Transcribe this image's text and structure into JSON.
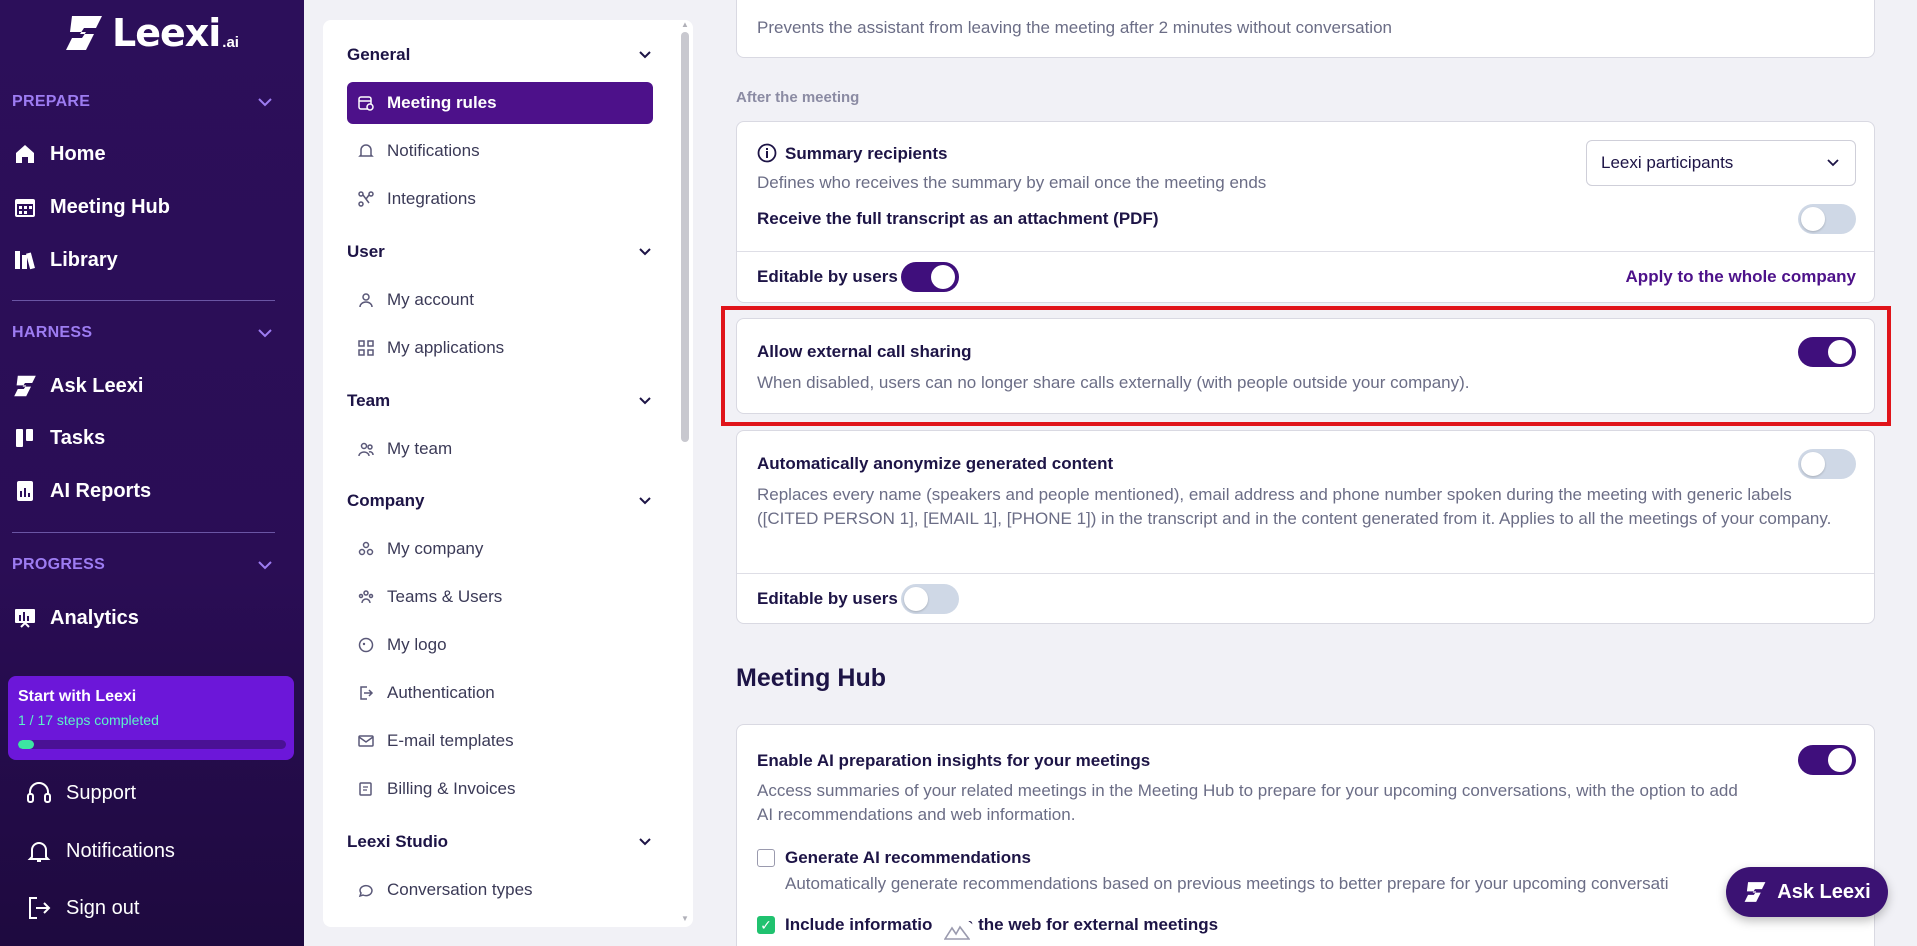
{
  "logo": {
    "name": "Leexi",
    "suffix": ".ai"
  },
  "sidebar": {
    "sections": [
      {
        "label": "PREPARE",
        "items": [
          {
            "label": "Home",
            "icon": "home-icon"
          },
          {
            "label": "Meeting Hub",
            "icon": "calendar-icon"
          },
          {
            "label": "Library",
            "icon": "library-icon"
          }
        ]
      },
      {
        "label": "HARNESS",
        "items": [
          {
            "label": "Ask Leexi",
            "icon": "leexi-icon"
          },
          {
            "label": "Tasks",
            "icon": "tasks-icon"
          },
          {
            "label": "AI Reports",
            "icon": "report-icon"
          }
        ]
      },
      {
        "label": "PROGRESS",
        "items": [
          {
            "label": "Analytics",
            "icon": "analytics-icon"
          }
        ]
      }
    ],
    "start_card": {
      "title": "Start with Leexi",
      "steps": "1 / 17 steps completed",
      "progress": 0.06
    },
    "bottom": [
      {
        "label": "Support",
        "icon": "headset-icon"
      },
      {
        "label": "Notifications",
        "icon": "bell-icon"
      },
      {
        "label": "Sign out",
        "icon": "sign-out-icon"
      }
    ]
  },
  "settings_menu": {
    "groups": [
      {
        "label": "General",
        "items": [
          {
            "label": "Meeting rules",
            "icon": "calendar-cog-icon",
            "active": true
          },
          {
            "label": "Notifications",
            "icon": "bell-icon"
          },
          {
            "label": "Integrations",
            "icon": "integrations-icon"
          }
        ]
      },
      {
        "label": "User",
        "items": [
          {
            "label": "My account",
            "icon": "user-icon"
          },
          {
            "label": "My applications",
            "icon": "apps-icon"
          }
        ]
      },
      {
        "label": "Team",
        "items": [
          {
            "label": "My team",
            "icon": "team-icon"
          }
        ]
      },
      {
        "label": "Company",
        "items": [
          {
            "label": "My company",
            "icon": "company-icon"
          },
          {
            "label": "Teams & Users",
            "icon": "users-icon"
          },
          {
            "label": "My logo",
            "icon": "logo-icon"
          },
          {
            "label": "Authentication",
            "icon": "auth-icon"
          },
          {
            "label": "E-mail templates",
            "icon": "mail-icon"
          },
          {
            "label": "Billing & Invoices",
            "icon": "billing-icon"
          }
        ]
      },
      {
        "label": "Leexi Studio",
        "items": [
          {
            "label": "Conversation types",
            "icon": "conversation-icon"
          }
        ]
      }
    ]
  },
  "main": {
    "top_card": {
      "description": "Prevents the assistant from leaving the meeting after 2 minutes without conversation"
    },
    "after_meeting_label": "After the meeting",
    "summary": {
      "title": "Summary recipients",
      "description": "Defines who receives the summary by email once the meeting ends",
      "select_value": "Leexi participants",
      "transcript_label": "Receive the full transcript as an attachment (PDF)",
      "transcript_on": false,
      "editable_label": "Editable by users",
      "editable_on": true,
      "apply_link": "Apply to the whole company"
    },
    "external_sharing": {
      "title": "Allow external call sharing",
      "description": "When disabled, users can no longer share calls externally (with people outside your company).",
      "on": true
    },
    "anonymize": {
      "title": "Automatically anonymize generated content",
      "description": "Replaces every name (speakers and people mentioned), email address and phone number spoken during the meeting with generic labels ([CITED PERSON 1], [EMAIL 1], [PHONE 1]) in the transcript and in the content generated from it. Applies to all the meetings of your company.",
      "on": false,
      "editable_label": "Editable by users",
      "editable_on": false
    },
    "meeting_hub": {
      "heading": "Meeting Hub",
      "ai_prep": {
        "title": "Enable AI preparation insights for your meetings",
        "description": "Access summaries of your related meetings in the Meeting Hub to prepare for your upcoming conversations, with the option to add AI recommendations and web information.",
        "on": true
      },
      "recommendations": {
        "title": "Generate AI recommendations",
        "description": "Automatically generate recommendations based on previous meetings to better prepare for your upcoming conversati",
        "checked": false
      },
      "web_info": {
        "title_left": "Include informatio",
        "title_right": "n the web for external meetings",
        "checked": true
      }
    }
  },
  "ask_button": {
    "label": "Ask Leexi"
  }
}
